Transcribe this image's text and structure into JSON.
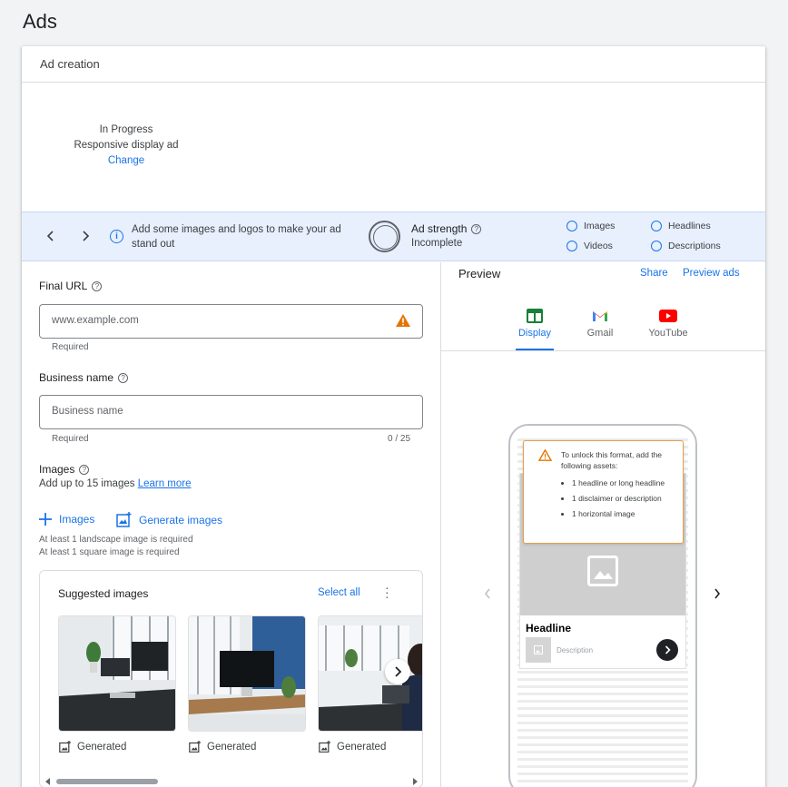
{
  "page": {
    "title": "Ads"
  },
  "card": {
    "header": "Ad creation"
  },
  "status": {
    "state": "In Progress",
    "type": "Responsive display ad",
    "change_label": "Change"
  },
  "strength_bar": {
    "tip": "Add some images and logos to make your ad stand out",
    "label": "Ad strength",
    "value": "Incomplete",
    "checks": [
      "Images",
      "Videos",
      "Headlines",
      "Descriptions"
    ]
  },
  "form": {
    "final_url": {
      "label": "Final URL",
      "value": "www.example.com",
      "hint": "Required"
    },
    "business_name": {
      "label": "Business name",
      "placeholder": "Business name",
      "hint": "Required",
      "counter": "0 / 25"
    },
    "images": {
      "label": "Images",
      "subtext": "Add up to 15 images",
      "learn_more": "Learn more",
      "add_label": "Images",
      "generate_label": "Generate images",
      "note_landscape": "At least 1 landscape image is required",
      "note_square": "At least 1 square image is required"
    },
    "suggested": {
      "title": "Suggested images",
      "select_all": "Select all",
      "captions": [
        "Generated",
        "Generated",
        "Generated"
      ]
    }
  },
  "preview": {
    "title": "Preview",
    "share": "Share",
    "preview_ads": "Preview ads",
    "tabs": [
      "Display",
      "Gmail",
      "YouTube"
    ],
    "active_tab": "Display",
    "unlock": {
      "message": "To unlock this format, add the following assets:",
      "items": [
        "1 headline or long headline",
        "1 disclaimer or description",
        "1 horizontal image"
      ]
    },
    "ad": {
      "headline": "Headline",
      "description": "Description"
    }
  },
  "colors": {
    "accent": "#1a73e8",
    "warning": "#e37400",
    "info_bar": "#e8f0fe"
  }
}
